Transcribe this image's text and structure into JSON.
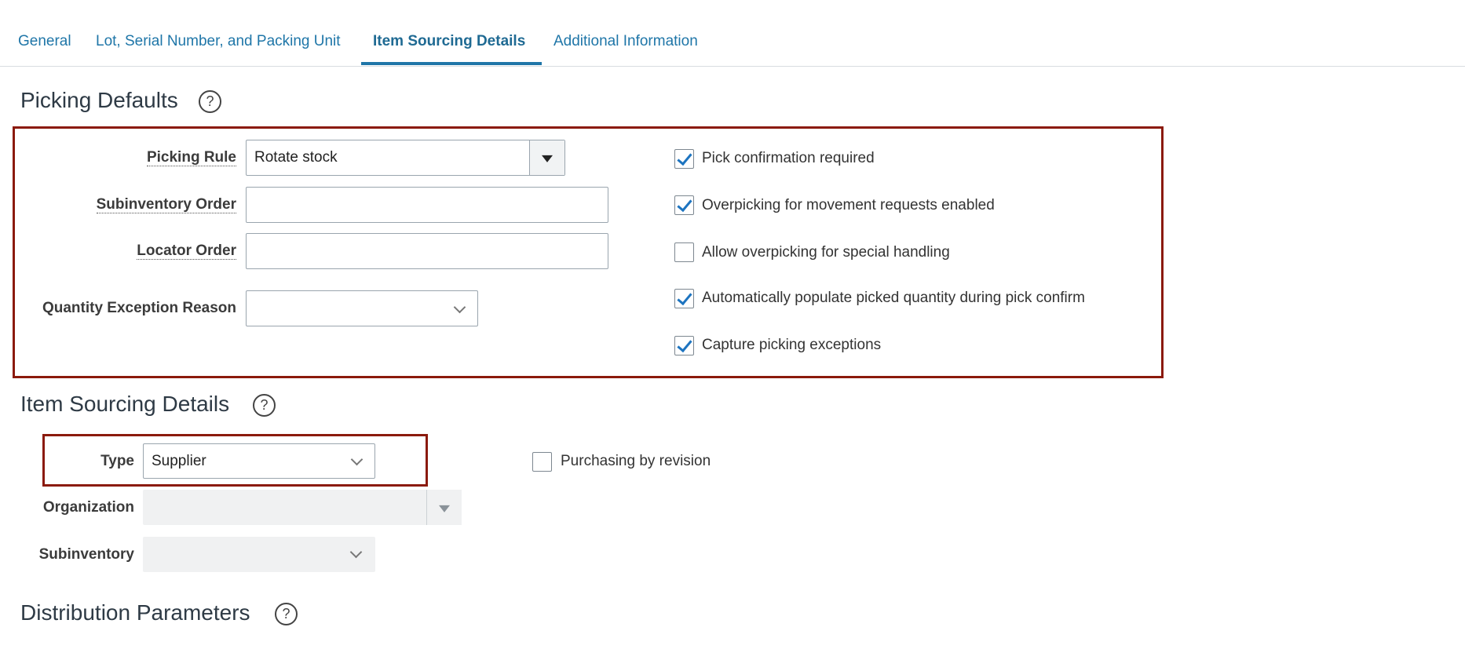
{
  "tabs": [
    {
      "label": "General"
    },
    {
      "label": "Lot, Serial Number, and Packing Unit"
    },
    {
      "label": "Item Sourcing Details"
    },
    {
      "label": "Additional Information"
    }
  ],
  "picking": {
    "title": "Picking Defaults",
    "help": "?",
    "rule_label": "Picking Rule",
    "rule_value": "Rotate stock",
    "subinventory_order_label": "Subinventory Order",
    "subinventory_order_value": "",
    "locator_order_label": "Locator Order",
    "locator_order_value": "",
    "qty_exception_label": "Quantity Exception Reason",
    "qty_exception_value": "",
    "checkboxes": [
      {
        "label": "Pick confirmation required",
        "checked": true
      },
      {
        "label": "Overpicking for movement requests enabled",
        "checked": true
      },
      {
        "label": "Allow overpicking for special handling",
        "checked": false
      },
      {
        "label": "Automatically populate picked quantity during pick confirm",
        "checked": true
      },
      {
        "label": "Capture picking exceptions",
        "checked": true
      }
    ]
  },
  "sourcing": {
    "title": "Item Sourcing Details",
    "help": "?",
    "type_label": "Type",
    "type_value": "Supplier",
    "org_label": "Organization",
    "org_value": "",
    "subinv_label": "Subinventory",
    "subinv_value": "",
    "purchasing_label": "Purchasing by revision",
    "purchasing_checked": false
  },
  "distribution": {
    "title": "Distribution Parameters",
    "help": "?"
  },
  "colors": {
    "accent": "#1f76a8",
    "highlight_box": "#8b1a0c",
    "checkbox_check": "#1d74c0"
  }
}
